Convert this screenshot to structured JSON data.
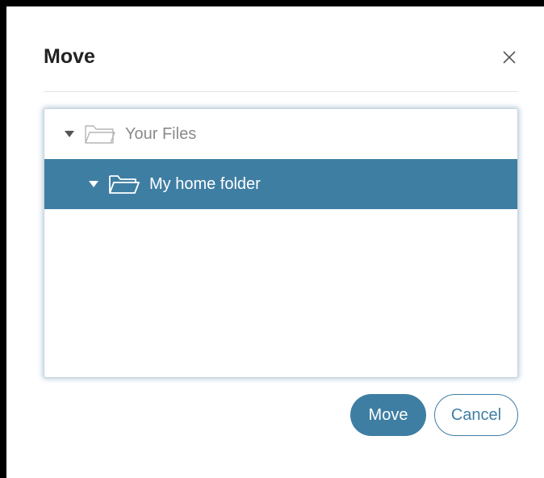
{
  "dialog": {
    "title": "Move",
    "close_icon": "close-icon"
  },
  "tree": {
    "items": [
      {
        "label": "Your Files",
        "icon": "folder-outline-icon",
        "expanded": true,
        "selected": false
      },
      {
        "label": "My home folder",
        "icon": "folder-open-icon",
        "expanded": true,
        "selected": true
      }
    ]
  },
  "buttons": {
    "move_label": "Move",
    "cancel_label": "Cancel"
  },
  "colors": {
    "accent": "#3f7ea3",
    "muted_text": "#8a8a8a"
  }
}
